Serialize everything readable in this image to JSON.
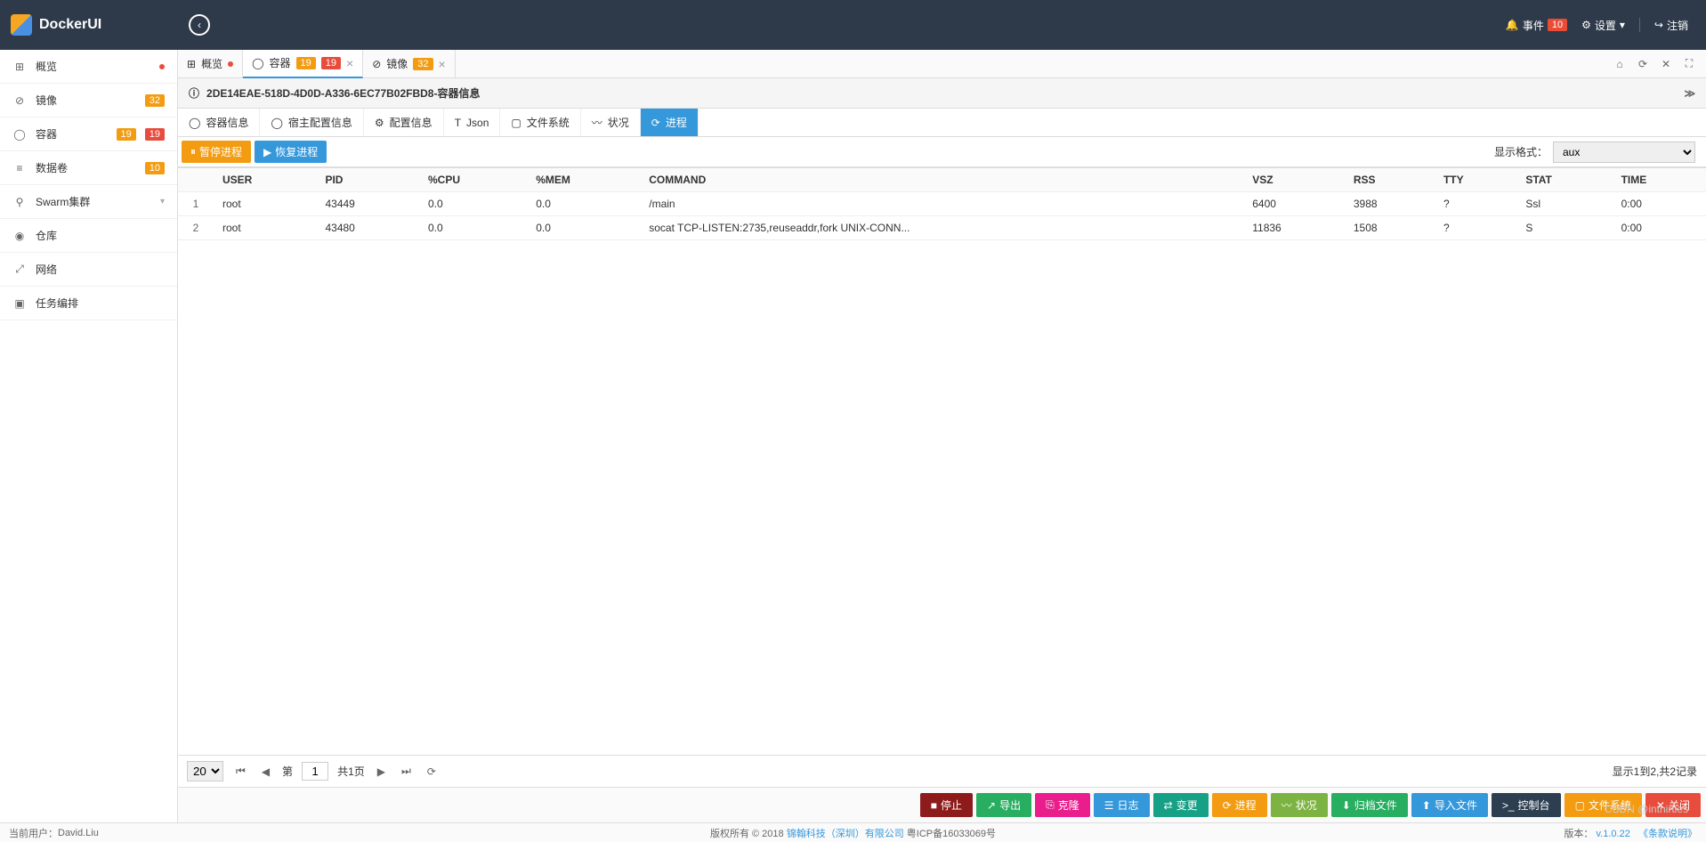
{
  "header": {
    "app_name": "DockerUI",
    "events_label": "事件",
    "events_count": "10",
    "settings_label": "设置",
    "logout_label": "注销"
  },
  "sidebar": {
    "items": [
      {
        "icon": "⊞",
        "label": "概览",
        "dot": true
      },
      {
        "icon": "⊘",
        "label": "镜像",
        "badges": [
          {
            "text": "32",
            "cls": "badge-orange"
          }
        ]
      },
      {
        "icon": "◯",
        "label": "容器",
        "badges": [
          {
            "text": "19",
            "cls": "badge-orange"
          },
          {
            "text": "19",
            "cls": "badge-red"
          }
        ]
      },
      {
        "icon": "≡",
        "label": "数据卷",
        "badges": [
          {
            "text": "10",
            "cls": "badge-orange"
          }
        ]
      },
      {
        "icon": "⚲",
        "label": "Swarm集群",
        "chevron": true
      },
      {
        "icon": "◉",
        "label": "仓库"
      },
      {
        "icon": "⤢",
        "label": "网络"
      },
      {
        "icon": "▣",
        "label": "任务编排"
      }
    ]
  },
  "tabs": [
    {
      "icon": "⊞",
      "label": "概览",
      "dot": true,
      "closable": false
    },
    {
      "icon": "◯",
      "label": "容器",
      "badges": [
        {
          "text": "19",
          "cls": "badge-orange"
        },
        {
          "text": "19",
          "cls": "badge-red"
        }
      ],
      "closable": true,
      "active": true
    },
    {
      "icon": "⊘",
      "label": "镜像",
      "badges": [
        {
          "text": "32",
          "cls": "badge-orange"
        }
      ],
      "closable": true
    }
  ],
  "info_bar": {
    "icon": "ⓘ",
    "text": "2DE14EAE-518D-4D0D-A336-6EC77B02FBD8-容器信息"
  },
  "subtabs": [
    {
      "icon": "◯",
      "label": "容器信息"
    },
    {
      "icon": "◯",
      "label": "宿主配置信息"
    },
    {
      "icon": "⚙",
      "label": "配置信息"
    },
    {
      "icon": "T",
      "label": "Json"
    },
    {
      "icon": "▢",
      "label": "文件系统"
    },
    {
      "icon": "〰",
      "label": "状况"
    },
    {
      "icon": "⟳",
      "label": "进程",
      "active": true
    }
  ],
  "toolbar": {
    "pause_label": "暂停进程",
    "resume_label": "恢复进程",
    "format_label": "显示格式：",
    "format_value": "aux"
  },
  "table": {
    "headers": [
      "",
      "USER",
      "PID",
      "%CPU",
      "%MEM",
      "COMMAND",
      "VSZ",
      "RSS",
      "TTY",
      "STAT",
      "TIME"
    ],
    "rows": [
      {
        "idx": "1",
        "user": "root",
        "pid": "43449",
        "cpu": "0.0",
        "mem": "0.0",
        "cmd": "/main",
        "vsz": "6400",
        "rss": "3988",
        "tty": "?",
        "stat": "Ssl",
        "time": "0:00"
      },
      {
        "idx": "2",
        "user": "root",
        "pid": "43480",
        "cpu": "0.0",
        "mem": "0.0",
        "cmd": "socat TCP-LISTEN:2735,reuseaddr,fork UNIX-CONN...",
        "vsz": "11836",
        "rss": "1508",
        "tty": "?",
        "stat": "S",
        "time": "0:00"
      }
    ]
  },
  "pager": {
    "page_size": "20",
    "page_label_pre": "第",
    "page_value": "1",
    "page_total": "共1页",
    "info": "显示1到2,共2记录"
  },
  "bottom_actions": [
    {
      "label": "停止",
      "color": "#8e1b1b",
      "icon": "■"
    },
    {
      "label": "导出",
      "color": "#27ae60",
      "icon": "↗"
    },
    {
      "label": "克隆",
      "color": "#e91e8c",
      "icon": "⎘"
    },
    {
      "label": "日志",
      "color": "#3498db",
      "icon": "☰"
    },
    {
      "label": "变更",
      "color": "#16a085",
      "icon": "⇄"
    },
    {
      "label": "进程",
      "color": "#f39c12",
      "icon": "⟳"
    },
    {
      "label": "状况",
      "color": "#7cb342",
      "icon": "〰"
    },
    {
      "label": "归档文件",
      "color": "#27ae60",
      "icon": "⬇"
    },
    {
      "label": "导入文件",
      "color": "#3498db",
      "icon": "⬆"
    },
    {
      "label": "控制台",
      "color": "#2c3e50",
      "icon": ">_"
    },
    {
      "label": "文件系统",
      "color": "#f39c12",
      "icon": "▢"
    },
    {
      "label": "关闭",
      "color": "#e74c3c",
      "icon": "✕"
    }
  ],
  "footer": {
    "user_label": "当前用户：",
    "user_name": "David.Liu",
    "copyright": "版权所有 © 2018 ",
    "company": "锦翰科技（深圳）有限公司",
    "icp": " 粤ICP备16033069号",
    "version_label": "版本：",
    "version": "v.1.0.22",
    "terms": "《条款说明》"
  },
  "watermark": "CSDN @inthirties"
}
